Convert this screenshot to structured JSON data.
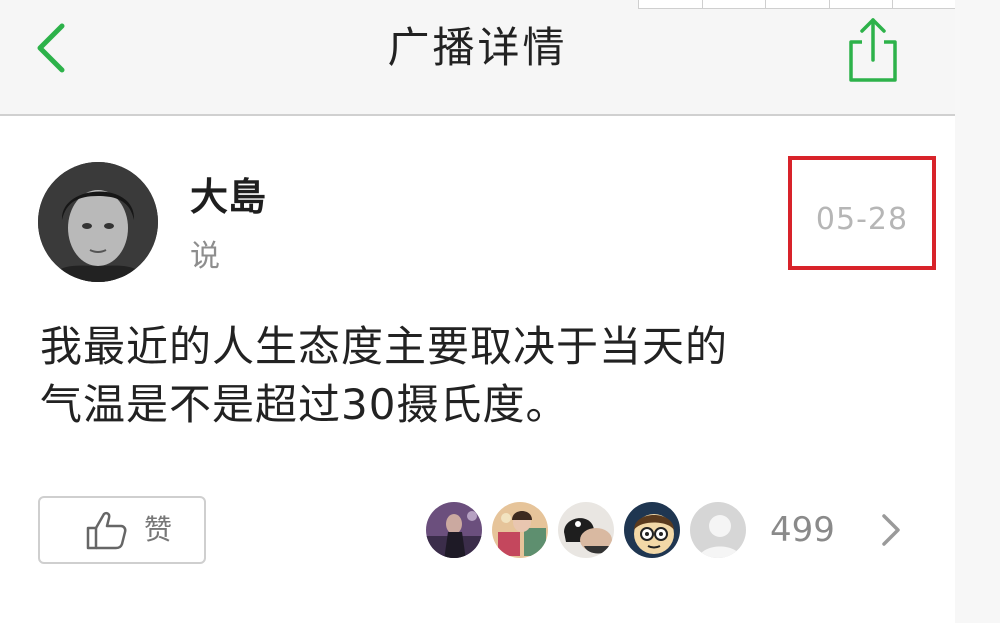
{
  "nav": {
    "title": "广播详情",
    "back_icon": "chevron-left-icon",
    "share_icon": "share-icon",
    "accent_color": "#2db24a"
  },
  "post": {
    "author": "大島",
    "action": "说",
    "date": "05-28",
    "highlight_color": "#d8232a",
    "text_lines": [
      "我最近的人生态度主要取决于当天的",
      "气温是不是超过30摄氏度。"
    ]
  },
  "footer": {
    "like_label": "赞",
    "like_icon": "thumbs-up-icon",
    "like_count": "499",
    "likers": [
      {
        "name": "liker-avatar-1"
      },
      {
        "name": "liker-avatar-2"
      },
      {
        "name": "liker-avatar-3"
      },
      {
        "name": "liker-avatar-4"
      },
      {
        "name": "liker-avatar-5"
      }
    ],
    "more_icon": "chevron-right-icon"
  }
}
